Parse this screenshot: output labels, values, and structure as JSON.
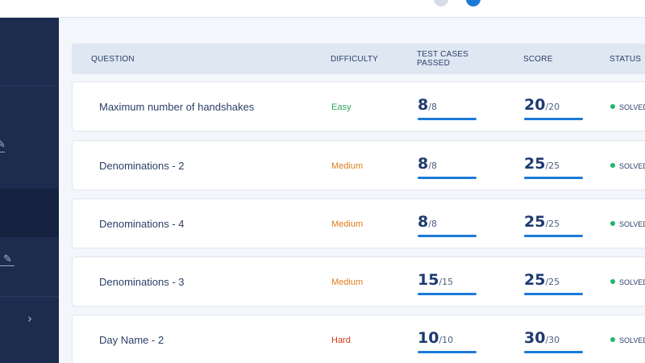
{
  "colors": {
    "sidebar": "#1c2b4e",
    "accent": "#1c7bd8",
    "easy": "#2aa65c",
    "medium": "#e07b1e",
    "hard": "#d13a1c",
    "solved": "#21b56b"
  },
  "table": {
    "headers": {
      "question": "QUESTION",
      "difficulty": "DIFFICULTY",
      "test_cases_1": "TEST CASES",
      "test_cases_2": "PASSED",
      "score": "SCORE",
      "status": "STATUS"
    },
    "rows": [
      {
        "question": "Maximum number of handshakes",
        "difficulty": "Easy",
        "level": "easy",
        "passed": "8",
        "total_cases": "/8",
        "passed_fraction": 1.0,
        "score": "20",
        "max_score": "/20",
        "score_fraction": 1.0,
        "status": "SOLVED"
      },
      {
        "question": "Denominations - 2",
        "difficulty": "Medium",
        "level": "medium",
        "passed": "8",
        "total_cases": "/8",
        "passed_fraction": 1.0,
        "score": "25",
        "max_score": "/25",
        "score_fraction": 1.0,
        "status": "SOLVED"
      },
      {
        "question": "Denominations - 4",
        "difficulty": "Medium",
        "level": "medium",
        "passed": "8",
        "total_cases": "/8",
        "passed_fraction": 1.0,
        "score": "25",
        "max_score": "/25",
        "score_fraction": 1.0,
        "status": "SOLVED"
      },
      {
        "question": "Denominations - 3",
        "difficulty": "Medium",
        "level": "medium",
        "passed": "15",
        "total_cases": "/15",
        "passed_fraction": 1.0,
        "score": "25",
        "max_score": "/25",
        "score_fraction": 1.0,
        "status": "SOLVED"
      },
      {
        "question": "Day Name - 2",
        "difficulty": "Hard",
        "level": "hard",
        "passed": "10",
        "total_cases": "/10",
        "passed_fraction": 1.0,
        "score": "30",
        "max_score": "/30",
        "score_fraction": 1.0,
        "status": "SOLVED"
      }
    ]
  },
  "sidebar": {
    "icons": [
      "edit-icon",
      "pencil-icon",
      "chevron-right-icon"
    ],
    "glyphs": {
      "pencil": "✎",
      "chevron": "›"
    }
  }
}
